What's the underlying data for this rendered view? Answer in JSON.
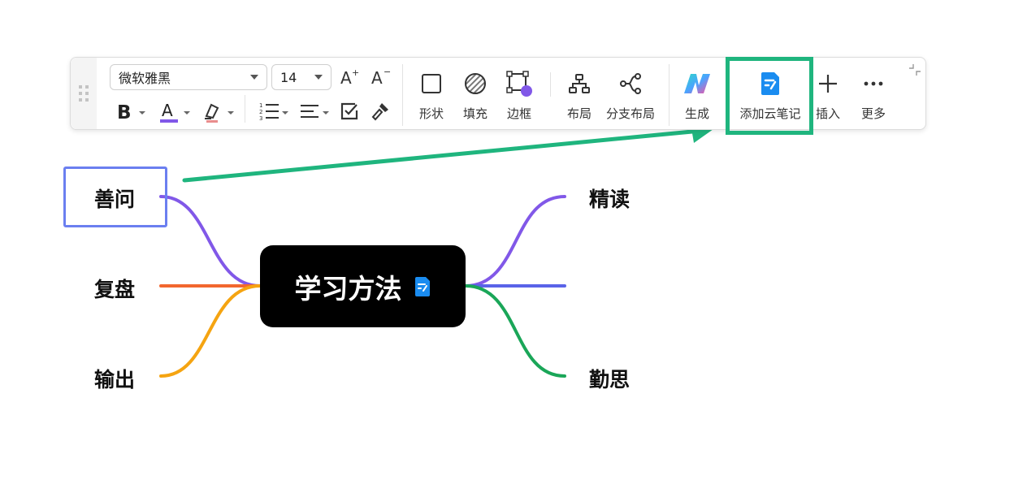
{
  "toolbar": {
    "font_family": "微软雅黑",
    "font_size": "14",
    "tools": {
      "shape": "形状",
      "fill": "填充",
      "border": "边框",
      "layout": "布局",
      "branch_layout": "分支布局",
      "generate": "生成",
      "add_cloud_note": "添加云笔记",
      "insert": "插入",
      "more": "更多"
    },
    "icons": [
      "drag-handle-icon",
      "font-increase-icon",
      "font-decrease-icon",
      "bold-icon",
      "font-color-icon",
      "highlighter-icon",
      "numbered-list-icon",
      "align-icon",
      "checkbox-icon",
      "format-painter-icon",
      "shape-icon",
      "fill-icon",
      "border-icon",
      "layout-icon",
      "branch-layout-icon",
      "ai-generate-icon",
      "cloud-note-icon",
      "plus-icon",
      "more-icon",
      "collapse-icon"
    ]
  },
  "mindmap": {
    "center": "学习方法",
    "left": [
      "善问",
      "复盘",
      "输出"
    ],
    "right": [
      "精读",
      "",
      "勤思"
    ],
    "colors": {
      "shanwen": "#8158e8",
      "fupan": "#f2672f",
      "shuchu": "#f5a411",
      "jingdu": "#8158e8",
      "middle": "#5a63e8",
      "qinsi": "#1aa658"
    }
  },
  "annotation": {
    "arrow_color": "#1fb57e",
    "highlight_color": "#1fb57e"
  }
}
